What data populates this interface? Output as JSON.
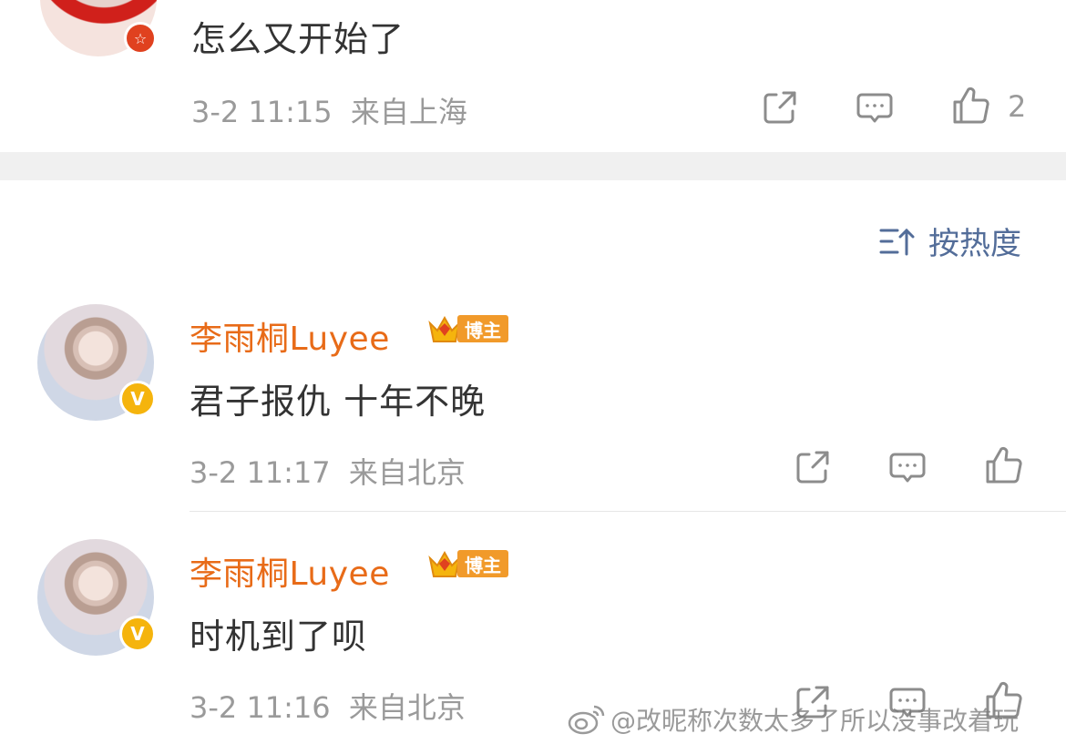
{
  "top_comment": {
    "text": "怎么又开始了",
    "time": "3-2 11:15",
    "location": "来自上海",
    "like_count": "2",
    "icons": {
      "share": "share-icon",
      "reply": "comment-icon",
      "like": "thumbs-up-icon",
      "badge": "star-badge-icon"
    }
  },
  "sort": {
    "label": "按热度",
    "icon": "sort-icon"
  },
  "replies": [
    {
      "username": "李雨桐Luyee",
      "badge_label": "博主",
      "text": "君子报仇 十年不晚",
      "time": "3-2 11:17",
      "location": "来自北京",
      "verified": "V"
    },
    {
      "username": "李雨桐Luyee",
      "badge_label": "博主",
      "text": "时机到了呗",
      "time": "3-2 11:16",
      "location": "来自北京",
      "verified": "V"
    }
  ],
  "watermark": {
    "text": "@改昵称次数太多了所以没事改着玩",
    "icon": "weibo-logo-icon"
  },
  "colors": {
    "accent": "#e86b18",
    "sort_blue": "#536d99",
    "meta_gray": "#9a9a9a",
    "badge_orange": "#f19a2a",
    "verified_yellow": "#f5b40d"
  }
}
